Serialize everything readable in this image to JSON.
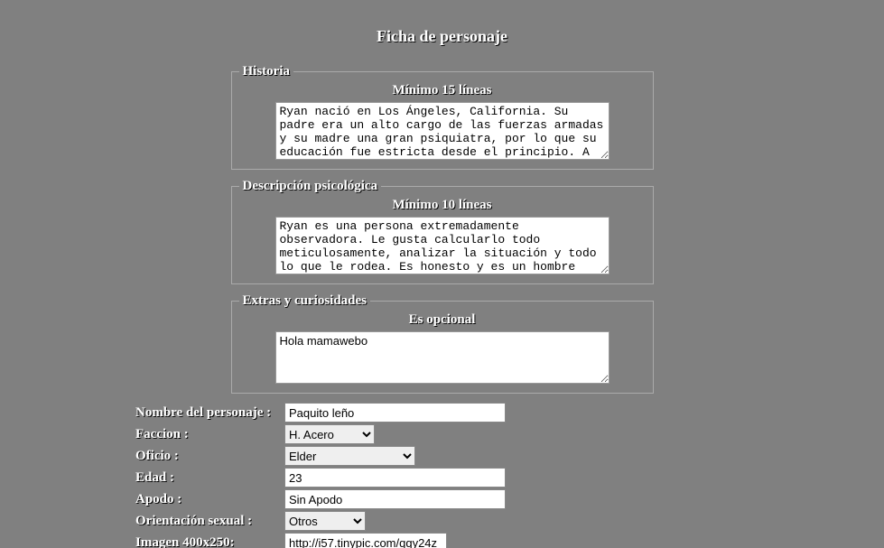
{
  "title": "Ficha de personaje",
  "historia": {
    "legend": "Historia",
    "subtitle": "Mínimo 15 líneas",
    "value": "Ryan nació en Los Ángeles, California. Su padre era un alto cargo de las fuerzas armadas y su madre una gran psiquiatra, por lo que su educación fue estricta desde el principio. A"
  },
  "descripcion": {
    "legend": "Descripción psicológica",
    "subtitle": "Mínimo 10 líneas",
    "value": "Ryan es una persona extremadamente observadora. Le gusta calcularlo todo meticulosamente, analizar la situación y todo lo que le rodea. Es honesto y es un hombre justo pero herido"
  },
  "extras": {
    "legend": "Extras y curiosidades",
    "subtitle": "Es opcional",
    "value": "Hola mamawebo"
  },
  "fields": {
    "nombre": {
      "label": "Nombre del personaje :",
      "value": "Paquito leño"
    },
    "faccion": {
      "label": "Faccion :",
      "value": "H. Acero"
    },
    "oficio": {
      "label": "Oficio :",
      "value": "Elder"
    },
    "edad": {
      "label": "Edad :",
      "value": "23"
    },
    "apodo": {
      "label": "Apodo :",
      "value": "Sin Apodo"
    },
    "orient": {
      "label": "Orientación sexual :",
      "value": "Otros"
    },
    "imagen": {
      "label": "Imagen 400x250:",
      "value": "http://i57.tinypic.com/qqy24z"
    }
  }
}
